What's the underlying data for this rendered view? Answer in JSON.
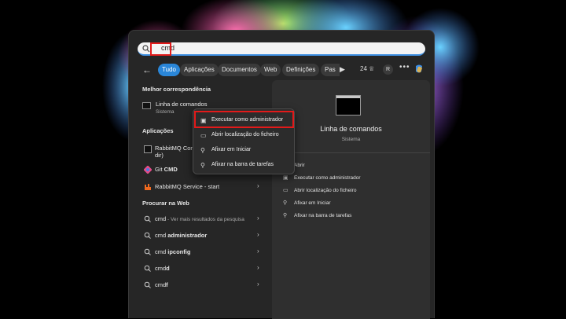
{
  "search": {
    "query": "cmd"
  },
  "filters": {
    "items": [
      "Tudo",
      "Aplicações",
      "Documentos",
      "Web",
      "Definições",
      "Pas"
    ],
    "play_icon": "play-icon",
    "points": "24",
    "avatar_letter": "R"
  },
  "sections": {
    "best_match": "Melhor correspondência",
    "apps": "Aplicações",
    "web": "Procurar na Web"
  },
  "best_match": {
    "name": "Linha de comandos",
    "subtitle": "Sistema"
  },
  "apps": [
    {
      "label": "RabbitMQ Com",
      "label2": "dir)"
    },
    {
      "label_pre": "Git ",
      "label_bold": "CMD"
    },
    {
      "label": "RabbitMQ Service - start"
    }
  ],
  "web_results": [
    {
      "pre": "cmd",
      "bold": "",
      "suffix": " - Ver mais resultados da pesquisa"
    },
    {
      "pre": "cmd ",
      "bold": "administrador",
      "suffix": ""
    },
    {
      "pre": "cmd ",
      "bold": "ipconfig",
      "suffix": ""
    },
    {
      "pre": "cmd",
      "bold": "d",
      "suffix": ""
    },
    {
      "pre": "cmd",
      "bold": "f",
      "suffix": ""
    }
  ],
  "context_menu": [
    "Executar como administrador",
    "Abrir localização do ficheiro",
    "Afixar em Iniciar",
    "Afixar na barra de tarefas"
  ],
  "right_panel": {
    "title": "Linha de comandos",
    "subtitle": "Sistema",
    "actions": [
      "Abrir",
      "Executar como administrador",
      "Abrir localização do ficheiro",
      "Afixar em Iniciar",
      "Afixar na barra de tarefas"
    ]
  },
  "colors": {
    "accent": "#2a86d8",
    "highlight": "#e21a1a",
    "panel": "#262626"
  }
}
